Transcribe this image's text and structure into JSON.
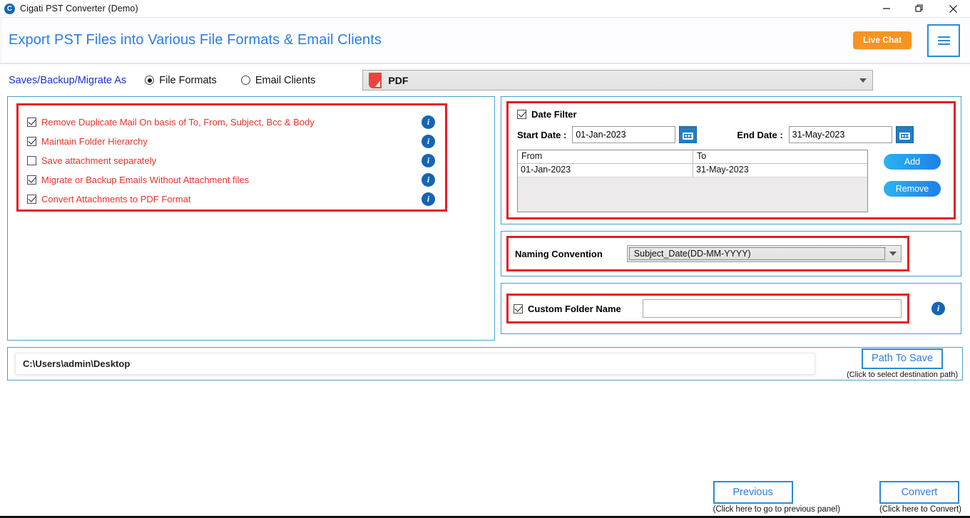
{
  "window": {
    "title": "Cigati PST Converter (Demo)",
    "logo_letter": "C",
    "controls": {
      "minimize": "minimize-icon",
      "restore": "restore-icon",
      "close": "close-icon"
    }
  },
  "header": {
    "title": "Export PST Files into Various File Formats & Email Clients",
    "live_chat": "Live Chat",
    "menu": "hamburger-menu"
  },
  "options": {
    "saveas_label": "Saves/Backup/Migrate As",
    "radios": [
      {
        "label": "File Formats",
        "selected": true
      },
      {
        "label": "Email Clients",
        "selected": false
      }
    ],
    "format_select": {
      "value": "PDF",
      "icon": "pdf-file-icon"
    }
  },
  "left_panel": {
    "checkboxes": [
      {
        "label": "Remove Duplicate Mail On basis of To, From, Subject, Bcc & Body",
        "checked": true
      },
      {
        "label": "Maintain Folder Hierarchy",
        "checked": true
      },
      {
        "label": "Save attachment separately",
        "checked": false
      },
      {
        "label": "Migrate or Backup Emails Without Attachment files",
        "checked": true
      },
      {
        "label": "Convert Attachments to PDF Format",
        "checked": true
      }
    ]
  },
  "date_filter": {
    "title": "Date Filter",
    "enabled": true,
    "start_label": "Start Date :",
    "start_value": "01-Jan-2023",
    "end_label": "End Date :",
    "end_value": "31-May-2023",
    "table": {
      "headers": [
        "From",
        "To"
      ],
      "rows": [
        [
          "01-Jan-2023",
          "31-May-2023"
        ]
      ]
    },
    "add_button": "Add",
    "remove_button": "Remove"
  },
  "naming_convention": {
    "label": "Naming Convention",
    "value": "Subject_Date(DD-MM-YYYY)"
  },
  "custom_folder": {
    "label": "Custom Folder Name",
    "checked": true,
    "value": ""
  },
  "path": {
    "value": "C:\\Users\\admin\\Desktop",
    "button": "Path To Save",
    "hint": "(Click to select destination path)"
  },
  "footer": {
    "previous": {
      "label": "Previous",
      "hint": "(Click here to go to previous panel)"
    },
    "convert": {
      "label": "Convert",
      "hint": "(Click here to Convert)"
    }
  },
  "colors": {
    "accent_blue": "#2b7de0",
    "red_highlight": "#e81c23",
    "orange": "#f79421",
    "panel_border": "#4a9ec9"
  }
}
